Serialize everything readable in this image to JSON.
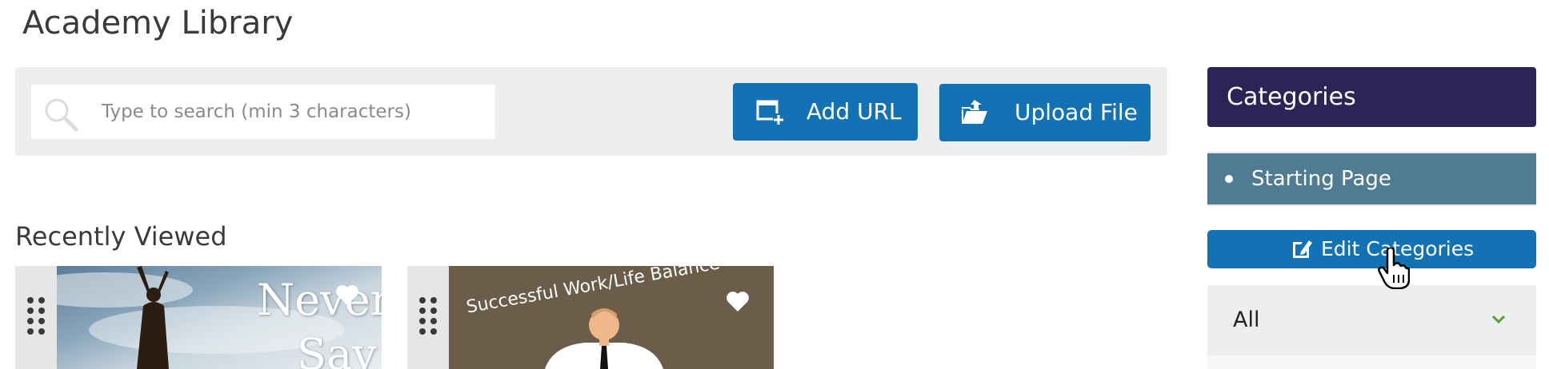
{
  "page": {
    "title": "Academy Library"
  },
  "toolbar": {
    "search": {
      "placeholder": "Type to search (min 3 characters)",
      "value": "",
      "icon": "search-icon"
    },
    "add_url": {
      "label": "Add URL",
      "icon": "add-window-icon"
    },
    "upload_file": {
      "label": "Upload File",
      "icon": "folder-upload-icon"
    }
  },
  "recently_viewed": {
    "title": "Recently Viewed",
    "items": [
      {
        "thumbnail_text_line1": "Never",
        "thumbnail_text_line2": "Say",
        "favorite_icon": "heart-icon"
      },
      {
        "thumbnail_caption": "Successful Work/Life Balance",
        "favorite_icon": "heart-icon"
      }
    ]
  },
  "sidebar": {
    "header": "Categories",
    "categories": [
      {
        "label": "Starting Page"
      }
    ],
    "edit_button": {
      "label": "Edit Categories",
      "icon": "edit-icon"
    },
    "filter": {
      "selected": "All",
      "icon": "chevron-down-icon"
    }
  },
  "colors": {
    "primary_blue": "#1372b3",
    "header_navy": "#2a2556",
    "category_teal": "#4f7c93",
    "panel_gray": "#eceef0",
    "chevron_green": "#5a9e2f"
  }
}
